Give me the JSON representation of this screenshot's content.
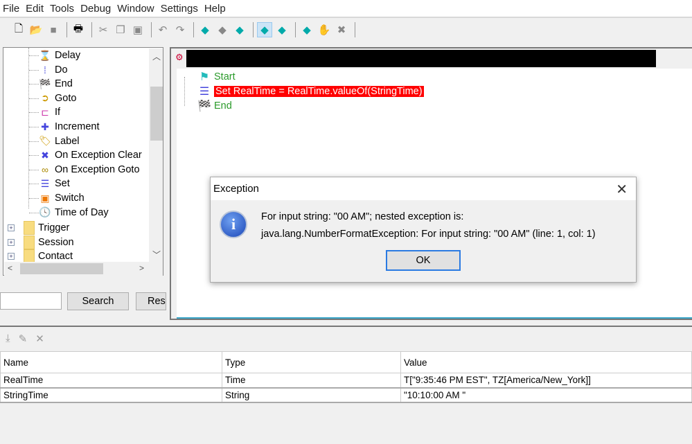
{
  "menu": [
    "File",
    "Edit",
    "Tools",
    "Debug",
    "Window",
    "Settings",
    "Help"
  ],
  "toolbar": [
    "new-file-icon",
    "open-folder-icon",
    "save-icon",
    "print-icon",
    "cut-icon",
    "copy-icon",
    "paste-icon",
    "undo-icon",
    "redo-icon",
    "run-icon",
    "pause-icon",
    "stop-icon",
    "step-over-icon",
    "step-into-icon",
    "step-out-icon",
    "breakpoint-icon",
    "clear-breakpoints-icon"
  ],
  "tree": {
    "children": [
      {
        "label": "Delay",
        "icon": "hourglass-icon"
      },
      {
        "label": "Do",
        "icon": "do-icon"
      },
      {
        "label": "End",
        "icon": "checkered-flag-icon"
      },
      {
        "label": "Goto",
        "icon": "goto-icon"
      },
      {
        "label": "If",
        "icon": "if-icon"
      },
      {
        "label": "Increment",
        "icon": "plus-icon"
      },
      {
        "label": "Label",
        "icon": "tag-icon"
      },
      {
        "label": "On Exception Clear",
        "icon": "exception-clear-icon"
      },
      {
        "label": "On Exception Goto",
        "icon": "exception-goto-icon"
      },
      {
        "label": "Set",
        "icon": "set-icon"
      },
      {
        "label": "Switch",
        "icon": "switch-icon"
      },
      {
        "label": "Time of Day",
        "icon": "clock-icon"
      }
    ],
    "folders": [
      "Trigger",
      "Session",
      "Contact"
    ]
  },
  "search": {
    "value": "",
    "button": "Search",
    "reset": "Res"
  },
  "script": {
    "start": "Start",
    "set": "Set RealTime = RealTime.valueOf(StringTime)",
    "end": "End",
    "highlight_color": "#ff0000"
  },
  "dialog": {
    "title": "Exception",
    "line1": "For input string: \"00 AM\"; nested exception is:",
    "line2": "java.lang.NumberFormatException: For input string: \"00 AM\" (line: 1, col: 1)",
    "ok": "OK"
  },
  "variables": {
    "headers": [
      "Name",
      "Type",
      "Value"
    ],
    "rows": [
      [
        "RealTime",
        "Time",
        "T[\"9:35:46 PM EST\", TZ[America/New_York]]"
      ],
      [
        "StringTime",
        "String",
        "\"10:10:00 AM \""
      ]
    ]
  }
}
